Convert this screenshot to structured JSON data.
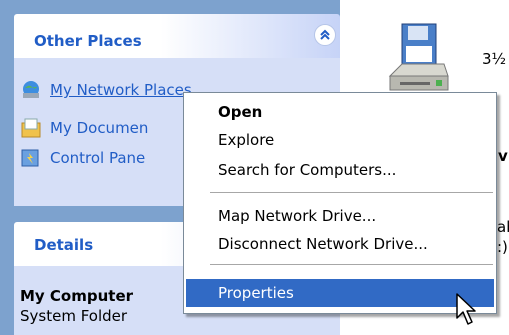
{
  "task_pane": {
    "other_places": {
      "title": "Other Places",
      "items": [
        {
          "label": "My Network Places",
          "icon": "network-places-icon"
        },
        {
          "label": "My Documen",
          "icon": "my-documents-icon"
        },
        {
          "label": "Control Pane",
          "icon": "control-panel-icon"
        }
      ],
      "collapse_icon": "chevron-up-double-icon"
    },
    "details": {
      "title": "Details",
      "name": "My Computer",
      "type": "System Folder"
    }
  },
  "content": {
    "drive_label_fragment": "3½",
    "fragment_a": "v",
    "fragment_b": "ab",
    "fragment_c": ":)"
  },
  "context_menu": {
    "items": [
      {
        "label": "Open",
        "default": true
      },
      {
        "label": "Explore"
      },
      {
        "label": "Search for Computers..."
      },
      {
        "label": "Map Network Drive..."
      },
      {
        "label": "Disconnect Network Drive..."
      },
      {
        "label": "Properties",
        "highlighted": true
      }
    ]
  },
  "colors": {
    "pane_background": "#7da2ce",
    "link_blue": "#215dc6",
    "highlight": "#316ac5"
  }
}
